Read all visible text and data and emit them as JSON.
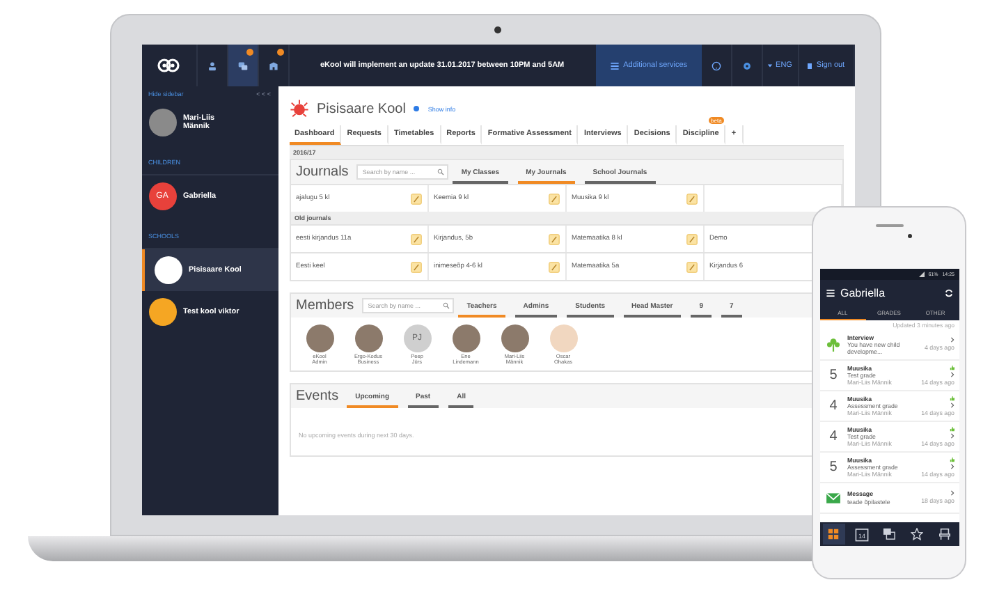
{
  "topbar": {
    "icons": [
      {
        "badge": false,
        "selected": false
      },
      {
        "badge": true,
        "selected": true
      },
      {
        "badge": true,
        "selected": false
      }
    ],
    "notice": "eKool will implement an update 31.01.2017 between 10PM and 5AM",
    "services": "Additional services",
    "language": "ENG",
    "sign_out": "Sign out"
  },
  "sidebar": {
    "hide": "Hide sidebar",
    "collapse": "< < <",
    "user": "Mari-Liis Männik",
    "children_heading": "CHILDREN",
    "children": [
      {
        "initials": "GA",
        "name": "Gabriella"
      }
    ],
    "schools_heading": "SCHOOLS",
    "schools": [
      {
        "name": "Pisisaare Kool",
        "selected": true
      },
      {
        "name": "Test kool viktor",
        "selected": false
      }
    ]
  },
  "school": {
    "name": "Pisisaare Kool",
    "show_info": "Show info"
  },
  "tabs": [
    {
      "label": "Dashboard",
      "selected": true
    },
    {
      "label": "Requests",
      "selected": false
    },
    {
      "label": "Timetables",
      "selected": false
    },
    {
      "label": "Reports",
      "selected": false
    },
    {
      "label": "Formative Assessment",
      "selected": false
    },
    {
      "label": "Interviews",
      "selected": false
    },
    {
      "label": "Decisions",
      "selected": false
    },
    {
      "label": "Discipline",
      "selected": false,
      "badge": "beta"
    }
  ],
  "add_tab": "+",
  "year": "2016/17",
  "journals": {
    "title": "Journals",
    "placeholder": "Search by name ...",
    "tabs": [
      {
        "label": "My Classes",
        "selected": false
      },
      {
        "label": "My Journals",
        "selected": true
      },
      {
        "label": "School Journals",
        "selected": false
      }
    ],
    "current": [
      "ajalugu 5 kl",
      "Keemia 9 kl",
      "Muusika 9 kl"
    ],
    "old_heading": "Old journals",
    "old": [
      [
        "eesti kirjandus 11a",
        "Kirjandus, 5b",
        "Matemaatika 8 kl",
        "Demo"
      ],
      [
        "Eesti keel",
        "inimeseõp 4-6 kl",
        "Matemaatika 5a",
        "Kirjandus 6"
      ]
    ]
  },
  "members": {
    "title": "Members",
    "placeholder": "Search by name ...",
    "tabs": [
      {
        "label": "Teachers",
        "selected": true
      },
      {
        "label": "Admins",
        "selected": false
      },
      {
        "label": "Students",
        "selected": false
      },
      {
        "label": "Head Master",
        "selected": false
      },
      {
        "label": "9",
        "selected": false
      },
      {
        "label": "7",
        "selected": false
      }
    ],
    "people": [
      {
        "first": "eKool",
        "last": "Admin",
        "kind": "photo"
      },
      {
        "first": "Ergo-Kodus",
        "last": "Business",
        "kind": "photo"
      },
      {
        "first": "Peep",
        "last": "Jürs",
        "kind": "initials",
        "initials": "PJ"
      },
      {
        "first": "Ene",
        "last": "Lindemann",
        "kind": "photo"
      },
      {
        "first": "Mari-Liis",
        "last": "Männik",
        "kind": "photo"
      },
      {
        "first": "Oscar",
        "last": "Ohakas",
        "kind": "cartoon"
      }
    ]
  },
  "events": {
    "title": "Events",
    "tabs": [
      {
        "label": "Upcoming",
        "selected": true
      },
      {
        "label": "Past",
        "selected": false
      },
      {
        "label": "All",
        "selected": false
      }
    ],
    "empty": "No upcoming events during next 30 days."
  },
  "phone": {
    "battery": "61%",
    "time": "14:25",
    "title": "Gabriella",
    "tabs": [
      {
        "label": "ALL",
        "selected": true
      },
      {
        "label": "GRADES",
        "selected": false
      },
      {
        "label": "OTHER",
        "selected": false
      }
    ],
    "updated": "Updated 3 minutes ago",
    "items": [
      {
        "kind": "interview",
        "title": "Interview",
        "text": "You have new child developme...",
        "time": "4 days ago"
      },
      {
        "kind": "grade",
        "grade": "5",
        "title": "Muusika",
        "text": "Test grade",
        "author": "Mari-Liis Männik",
        "time": "14 days ago"
      },
      {
        "kind": "grade",
        "grade": "4",
        "title": "Muusika",
        "text": "Assessment grade",
        "author": "Mari-Liis Männik",
        "time": "14 days ago"
      },
      {
        "kind": "grade",
        "grade": "4",
        "title": "Muusika",
        "text": "Test grade",
        "author": "Mari-Liis Männik",
        "time": "14 days ago"
      },
      {
        "kind": "grade",
        "grade": "5",
        "title": "Muusika",
        "text": "Assessment grade",
        "author": "Mari-Liis Männik",
        "time": "14 days ago"
      },
      {
        "kind": "message",
        "title": "Message",
        "text": "teade õpilastele",
        "time": "18 days ago"
      }
    ],
    "nav": [
      {
        "kind": "timetable",
        "selected": true
      },
      {
        "kind": "calendar",
        "selected": false,
        "label": "14"
      },
      {
        "kind": "conversations",
        "selected": false
      },
      {
        "kind": "grades",
        "selected": false
      },
      {
        "kind": "absences",
        "selected": false
      }
    ]
  }
}
